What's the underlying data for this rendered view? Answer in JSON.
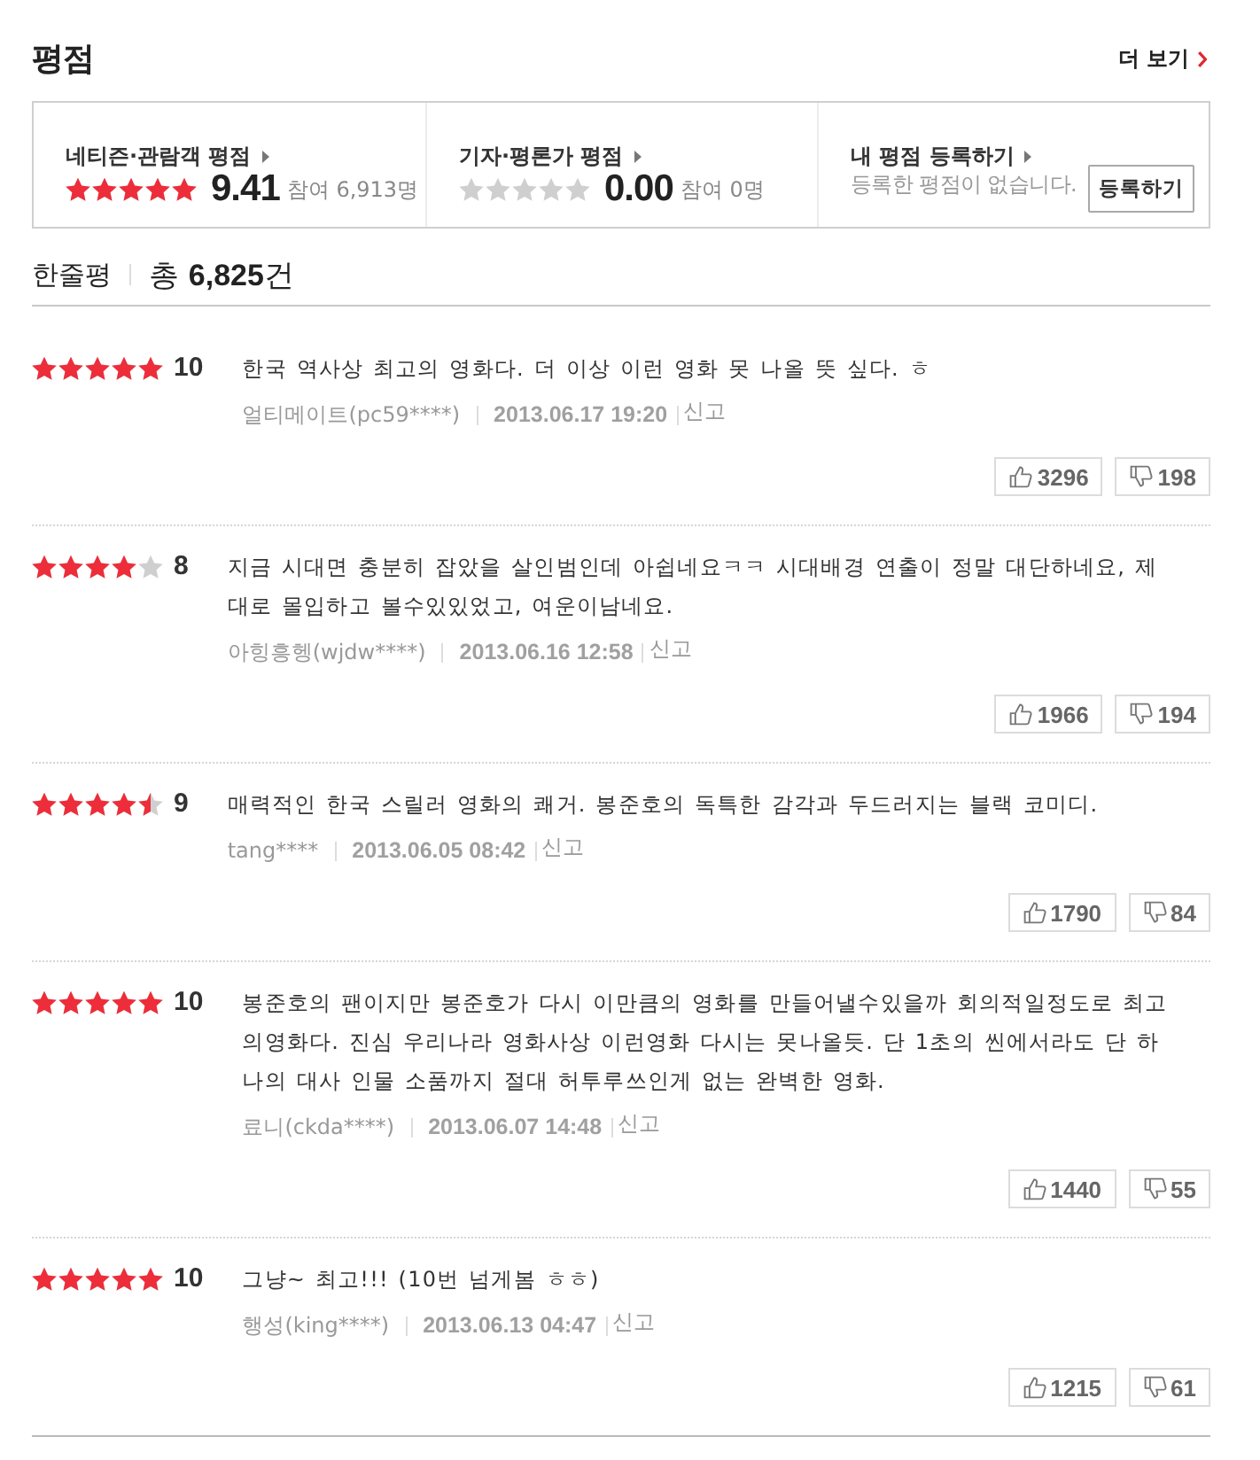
{
  "header": {
    "title": "평점",
    "more": "더 보기"
  },
  "summary": [
    {
      "kind": "rating",
      "label": "네티즌·관람객 평점",
      "stars": 5,
      "score": "9.41",
      "count": "참여 6,913명"
    },
    {
      "kind": "rating",
      "label": "기자·평론가 평점",
      "stars": 0,
      "score": "0.00",
      "count": "참여 0명"
    },
    {
      "kind": "register",
      "label": "내 평점 등록하기",
      "message": "등록한 평점이 없습니다.",
      "button": "등록하기"
    }
  ],
  "review_header": {
    "title": "한줄평",
    "total": "총 **6,825**건"
  },
  "reviews": [
    {
      "stars": 5,
      "score": "10",
      "text": "한국 역사상 최고의 영화다. 더 이상 이런 영화 못 나올 뜻 싶다. ㅎ",
      "user": "얼티메이트(pc59****)",
      "date": "2013.06.17 19:20",
      "report": "신고",
      "likes": "3296",
      "dislikes": "198"
    },
    {
      "stars": 4,
      "score": "8",
      "text": "지금 시대면 충분히 잡았을 살인범인데 아쉽네요ㅋㅋ 시대배경 연출이 정말 대단하네요, 제대로 몰입하고 볼수있있었고, 여운이남네요.",
      "user": "아힝흥헹(wjdw****)",
      "date": "2013.06.16 12:58",
      "report": "신고",
      "likes": "1966",
      "dislikes": "194"
    },
    {
      "stars": 4.5,
      "score": "9",
      "text": "매력적인 한국 스릴러 영화의 쾌거. 봉준호의 독특한 감각과 두드러지는 블랙 코미디.",
      "user": "tang****",
      "date": "2013.06.05 08:42",
      "report": "신고",
      "likes": "1790",
      "dislikes": "84"
    },
    {
      "stars": 5,
      "score": "10",
      "text": "봉준호의 팬이지만 봉준호가 다시 이만큼의 영화를 만들어낼수있을까 회의적일정도로 최고의영화다. 진심 우리나라 영화사상 이런영화 다시는 못나올듯. 단 1초의 씬에서라도 단 하나의 대사 인물 소품까지 절대 허투루쓰인게 없는 완벽한 영화.",
      "user": "료니(ckda****)",
      "date": "2013.06.07 14:48",
      "report": "신고",
      "likes": "1440",
      "dislikes": "55"
    },
    {
      "stars": 5,
      "score": "10",
      "text": "그냥~ 최고!!! (10번 넘게봄 ㅎㅎ)",
      "user": "행성(king****)",
      "date": "2013.06.13 04:47",
      "report": "신고",
      "likes": "1215",
      "dislikes": "61"
    }
  ]
}
